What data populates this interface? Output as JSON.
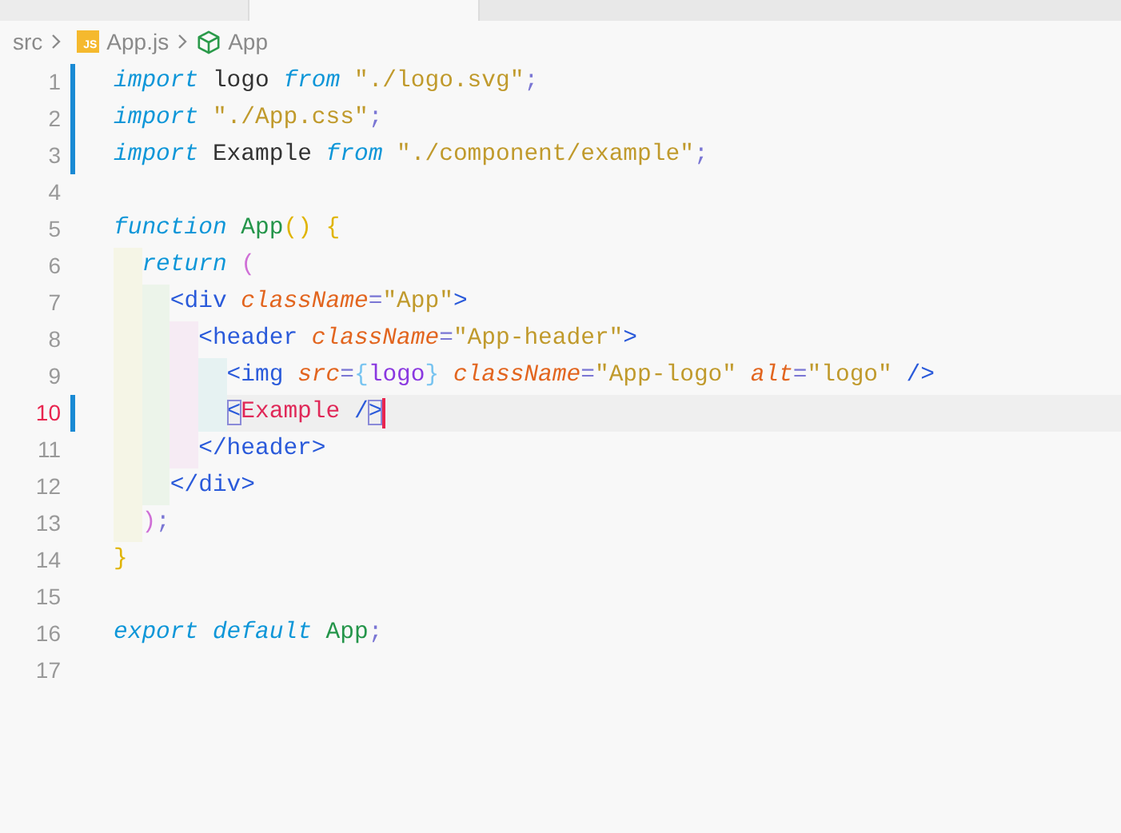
{
  "tabs": [
    {
      "selected": false
    },
    {
      "selected": true
    }
  ],
  "breadcrumb": {
    "folder": "src",
    "file_badge": "JS",
    "file": "App.js",
    "symbol": "App"
  },
  "lines": [
    {
      "number": "1",
      "modified": true,
      "current": false,
      "tokens": [
        {
          "kind": "keyword",
          "text": "import"
        },
        {
          "kind": "plain",
          "text": " logo "
        },
        {
          "kind": "keyword",
          "text": "from "
        },
        {
          "kind": "string",
          "text": "\"./logo.svg\""
        },
        {
          "kind": "punct",
          "text": ";"
        }
      ]
    },
    {
      "number": "2",
      "modified": true,
      "current": false,
      "tokens": [
        {
          "kind": "keyword",
          "text": "import "
        },
        {
          "kind": "string",
          "text": "\"./App.css\""
        },
        {
          "kind": "punct",
          "text": ";"
        }
      ]
    },
    {
      "number": "3",
      "modified": true,
      "current": false,
      "tokens": [
        {
          "kind": "keyword",
          "text": "import"
        },
        {
          "kind": "plain",
          "text": " Example "
        },
        {
          "kind": "keyword",
          "text": "from "
        },
        {
          "kind": "string",
          "text": "\"./component/example\""
        },
        {
          "kind": "punct",
          "text": ";"
        }
      ]
    },
    {
      "number": "4",
      "modified": false,
      "current": false
    },
    {
      "number": "5",
      "modified": false,
      "current": false,
      "tokens": [
        {
          "kind": "keyword",
          "text": "function "
        },
        {
          "kind": "function",
          "text": "App"
        },
        {
          "kind": "paren",
          "text": "() {"
        }
      ]
    },
    {
      "number": "6",
      "modified": false,
      "current": false,
      "tokens": [
        {
          "kind": "keyword",
          "text": "  return "
        },
        {
          "kind": "paren2",
          "text": "("
        }
      ]
    },
    {
      "number": "7",
      "modified": false,
      "current": false,
      "tokens": [
        {
          "kind": "tag",
          "text": "    <div "
        },
        {
          "kind": "attr",
          "text": "className"
        },
        {
          "kind": "punct",
          "text": "="
        },
        {
          "kind": "string",
          "text": "\"App\""
        },
        {
          "kind": "tag",
          "text": ">"
        }
      ]
    },
    {
      "number": "8",
      "modified": false,
      "current": false,
      "tokens": [
        {
          "kind": "tag",
          "text": "      <header "
        },
        {
          "kind": "attr",
          "text": "className"
        },
        {
          "kind": "punct",
          "text": "="
        },
        {
          "kind": "string",
          "text": "\"App-header\""
        },
        {
          "kind": "tag",
          "text": ">"
        }
      ]
    },
    {
      "number": "9",
      "modified": false,
      "current": false,
      "tokens": [
        {
          "kind": "tag",
          "text": "        <img "
        },
        {
          "kind": "attr",
          "text": "src"
        },
        {
          "kind": "punct",
          "text": "="
        },
        {
          "kind": "brace",
          "text": "{"
        },
        {
          "kind": "variable",
          "text": "logo"
        },
        {
          "kind": "brace",
          "text": "} "
        },
        {
          "kind": "attr",
          "text": "className"
        },
        {
          "kind": "punct",
          "text": "="
        },
        {
          "kind": "string",
          "text": "\"App-logo\" "
        },
        {
          "kind": "attr",
          "text": "alt"
        },
        {
          "kind": "punct",
          "text": "="
        },
        {
          "kind": "string",
          "text": "\"logo\" "
        },
        {
          "kind": "tag",
          "text": "/>"
        }
      ]
    },
    {
      "number": "10",
      "modified": true,
      "current": true,
      "tokens": [
        {
          "kind": "tag",
          "text": "        <",
          "matched": true
        },
        {
          "kind": "component",
          "text": "Example "
        },
        {
          "kind": "tag",
          "text": "/"
        },
        {
          "kind": "tag",
          "text": ">",
          "matched": true
        }
      ]
    },
    {
      "number": "11",
      "modified": false,
      "current": false,
      "tokens": [
        {
          "kind": "tag",
          "text": "      </header>"
        }
      ]
    },
    {
      "number": "12",
      "modified": false,
      "current": false,
      "tokens": [
        {
          "kind": "tag",
          "text": "    </div>"
        }
      ]
    },
    {
      "number": "13",
      "modified": false,
      "current": false,
      "tokens": [
        {
          "kind": "paren2",
          "text": "  )"
        },
        {
          "kind": "punct",
          "text": ";"
        }
      ]
    },
    {
      "number": "14",
      "modified": false,
      "current": false,
      "tokens": [
        {
          "kind": "paren",
          "text": "}"
        }
      ]
    },
    {
      "number": "15",
      "modified": false,
      "current": false
    },
    {
      "number": "16",
      "modified": false,
      "current": false,
      "tokens": [
        {
          "kind": "keyword",
          "text": "export default "
        },
        {
          "kind": "function",
          "text": "App"
        },
        {
          "kind": "punct",
          "text": ";"
        }
      ]
    },
    {
      "number": "17",
      "modified": false,
      "current": false
    }
  ]
}
